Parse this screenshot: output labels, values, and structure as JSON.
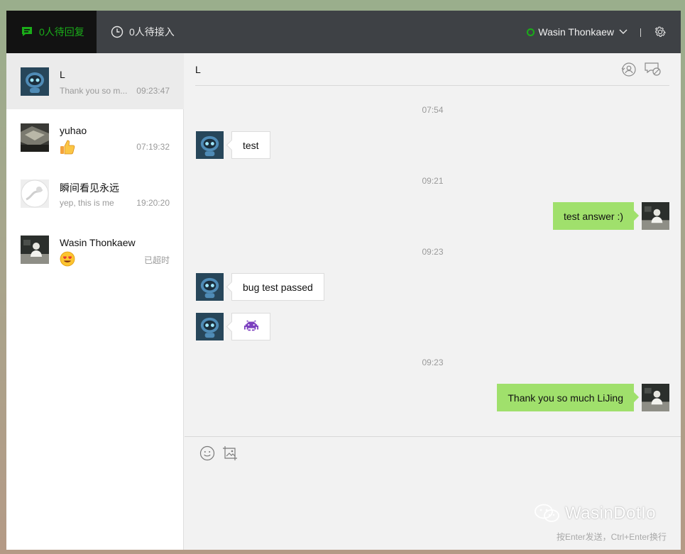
{
  "topbar": {
    "tab_pending_label": "0人待回复",
    "tab_waiting_label": "0人待接入",
    "agent_name": "Wasin Thonkaew",
    "accent_color": "#1aad19"
  },
  "sidebar": {
    "conversations": [
      {
        "name": "L",
        "preview": "Thank you so m...",
        "time": "09:23:47",
        "avatar": "robot-avatar"
      },
      {
        "name": "yuhao",
        "preview_emoji": "thumbs-up-emoji",
        "time": "07:19:32",
        "avatar": "photo-avatar"
      },
      {
        "name": "瞬间看见永远",
        "preview": "yep, this is me",
        "time": "19:20:20",
        "avatar": "light-avatar"
      },
      {
        "name": "Wasin Thonkaew",
        "preview_emoji": "heart-eyes-emoji",
        "time": "已超时",
        "avatar": "person-avatar"
      }
    ]
  },
  "chat": {
    "title": "L",
    "messages": [
      {
        "type": "time",
        "text": "07:54"
      },
      {
        "type": "in",
        "text": "test"
      },
      {
        "type": "time",
        "text": "09:21"
      },
      {
        "type": "out",
        "text": "test answer :)"
      },
      {
        "type": "time",
        "text": "09:23"
      },
      {
        "type": "in",
        "text": "bug test passed"
      },
      {
        "type": "in",
        "emoji": "space-invader-emoji"
      },
      {
        "type": "time",
        "text": "09:23"
      },
      {
        "type": "out",
        "text": "Thank you so much LiJing"
      }
    ]
  },
  "composer": {
    "hint": "按Enter发送，Ctrl+Enter换行"
  },
  "watermark": {
    "text": "WasinDotIo"
  }
}
